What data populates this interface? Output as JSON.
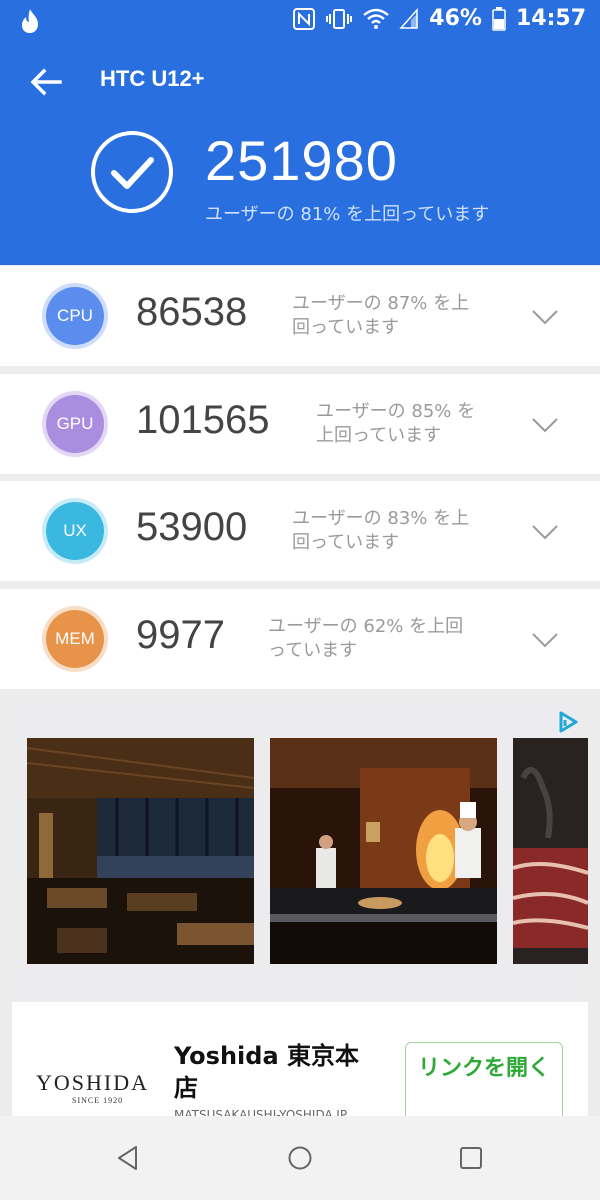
{
  "status_bar": {
    "battery": "46%",
    "time": "14:57"
  },
  "app_bar": {
    "title": "HTC U12+"
  },
  "total": {
    "score": "251980",
    "subtitle": "ユーザーの 81% を上回っています"
  },
  "categories": [
    {
      "badge": "CPU",
      "score": "86538",
      "desc_line1": "ユーザーの 87% を上",
      "desc_line2": "回っています",
      "color": "#5b8def",
      "ring": "#cfdcfa"
    },
    {
      "badge": "GPU",
      "score": "101565",
      "desc_line1": "ユーザーの 85% を",
      "desc_line2": "上回っています",
      "color": "#a98ee0",
      "ring": "#e2d8f6"
    },
    {
      "badge": "UX",
      "score": "53900",
      "desc_line1": "ユーザーの 83% を上",
      "desc_line2": "回っています",
      "color": "#3ab8e0",
      "ring": "#c8ecf7"
    },
    {
      "badge": "MEM",
      "score": "9977",
      "desc_line1": "ユーザーの 62% を上回",
      "desc_line2": "っています",
      "color": "#e8934a",
      "ring": "#f8dec6"
    }
  ],
  "ad": {
    "brand": "YOSHIDA",
    "brand_sub": "SINCE 1920",
    "title": "Yoshida 東京本店",
    "url": "MATSUSAKAUSHI-YOSHIDA.JP",
    "cta": "リンクを開く"
  },
  "colors": {
    "header": "#2a6fe0",
    "cta": "#2ea836"
  },
  "icons": [
    "tinder-flame-icon",
    "nfc-icon",
    "vibrate-icon",
    "wifi-icon",
    "signal-icon",
    "battery-icon",
    "back-arrow-icon",
    "check-circle-icon",
    "chevron-down-icon",
    "ad-choices-icon",
    "nav-back-icon",
    "nav-home-icon",
    "nav-recents-icon"
  ]
}
